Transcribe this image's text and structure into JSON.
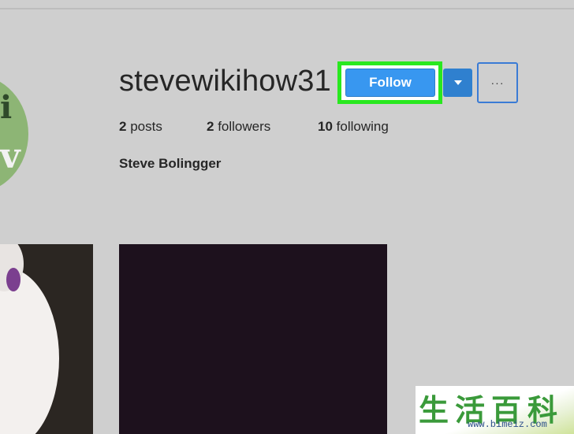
{
  "profile": {
    "username": "stevewikihow31",
    "full_name": "Steve Bolingger"
  },
  "actions": {
    "follow_label": "Follow",
    "more_label": "···"
  },
  "stats": {
    "posts_count": "2",
    "posts_label": "posts",
    "followers_count": "2",
    "followers_label": "followers",
    "following_count": "10",
    "following_label": "following"
  },
  "icons": {
    "dropdown": "chevron-down-icon",
    "more": "more-options-icon"
  },
  "colors": {
    "follow_button": "#3897f0",
    "highlight": "#29e81f",
    "background": "#cfcfcf"
  },
  "watermark": {
    "glyphs": "生活百科",
    "url": "www.bimeiz.com"
  }
}
